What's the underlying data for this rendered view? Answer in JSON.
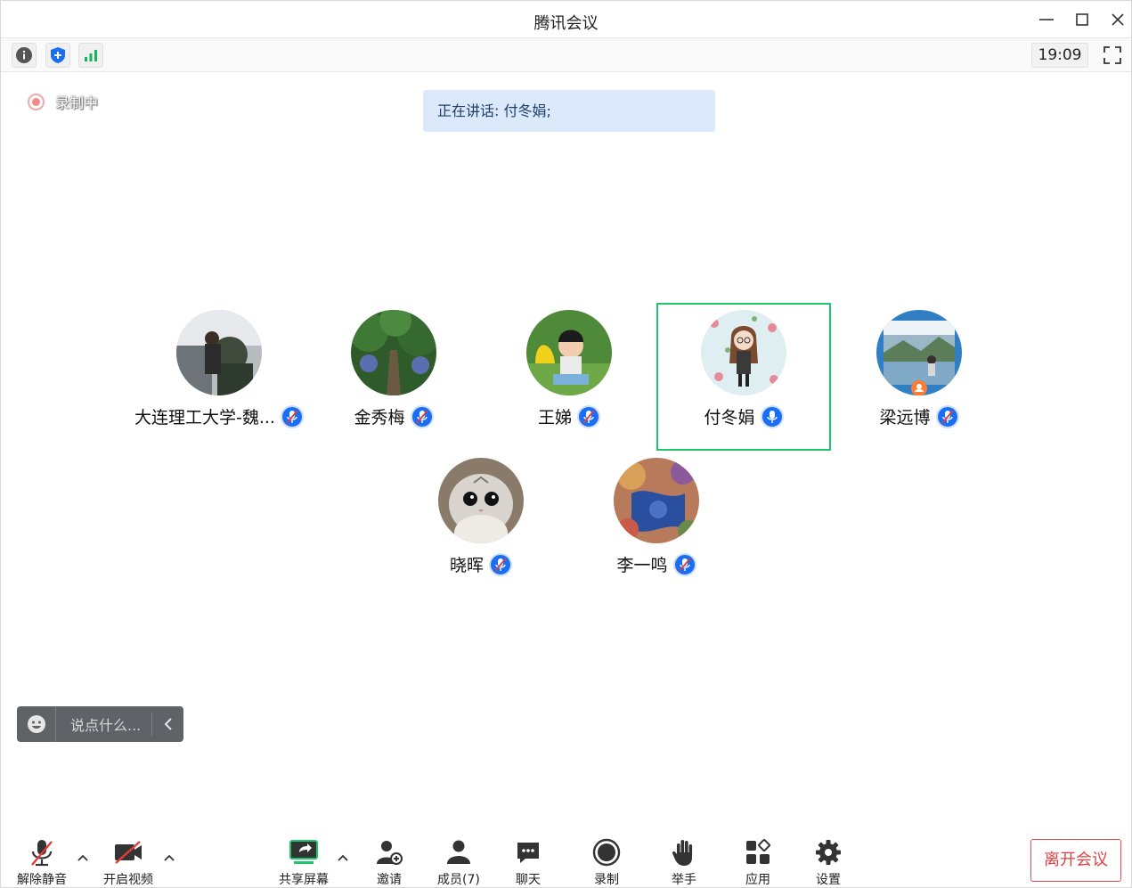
{
  "window": {
    "title": "腾讯会议"
  },
  "toolbar": {
    "time": "19:09"
  },
  "recording": {
    "label": "录制中"
  },
  "speaking": {
    "text": "正在讲话: 付冬娟;"
  },
  "participants": [
    {
      "name": "大连理工大学-魏...",
      "muted": true
    },
    {
      "name": "金秀梅",
      "muted": true
    },
    {
      "name": "王娣",
      "muted": true
    },
    {
      "name": "付冬娟",
      "muted": false,
      "active": true
    },
    {
      "name": "梁远博",
      "muted": true
    },
    {
      "name": "晓晖",
      "muted": true
    },
    {
      "name": "李一鸣",
      "muted": true
    }
  ],
  "chat": {
    "placeholder": "说点什么..."
  },
  "bottombar": {
    "unmute": "解除静音",
    "video": "开启视频",
    "share": "共享屏幕",
    "invite": "邀请",
    "members": "成员(7)",
    "chat": "聊天",
    "record": "录制",
    "raise_hand": "举手",
    "apps": "应用",
    "settings": "设置",
    "leave": "离开会议"
  },
  "colors": {
    "accent": "#1a6ef5",
    "active_border": "#1fc46b",
    "leave": "#e04040",
    "speaking_bg": "#dbe9fb"
  }
}
